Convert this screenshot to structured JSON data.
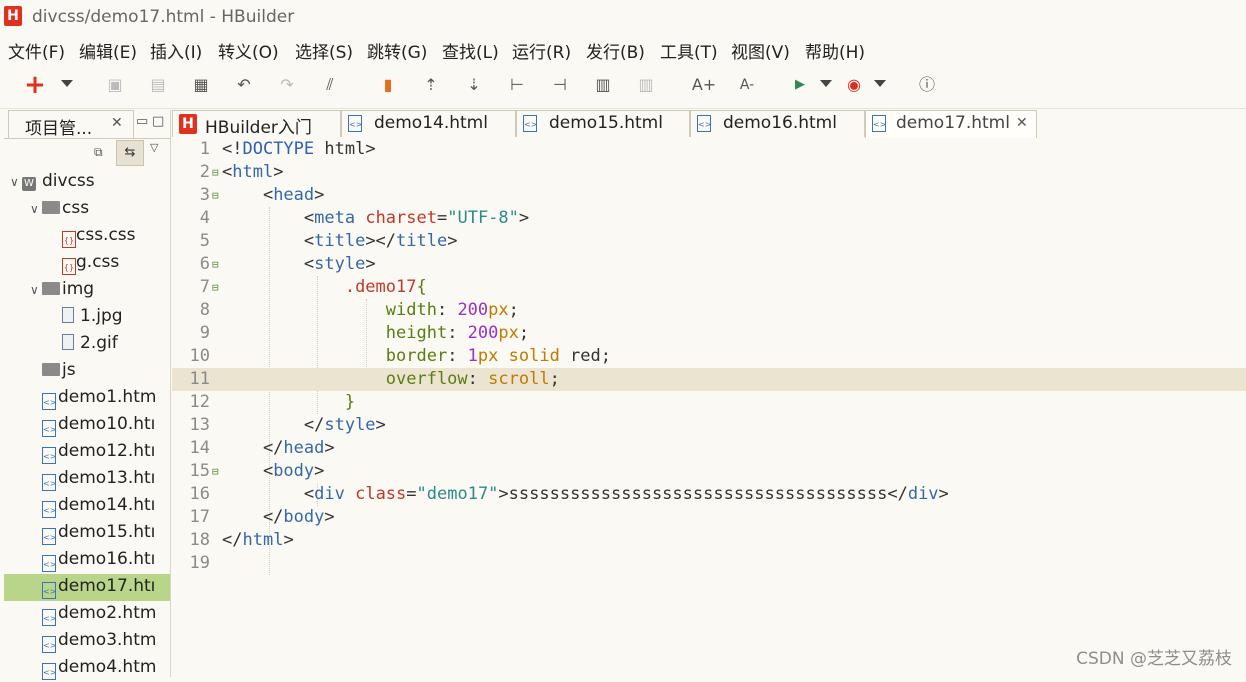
{
  "window": {
    "title": "divcss/demo17.html  -  HBuilder",
    "logo": "H"
  },
  "menu": [
    "文件(F)",
    "编辑(E)",
    "插入(I)",
    "转义(O)",
    "选择(S)",
    "跳转(G)",
    "查找(L)",
    "运行(R)",
    "发行(B)",
    "工具(T)",
    "视图(V)",
    "帮助(H)"
  ],
  "toolbar": {
    "icons": [
      "new-icon",
      "save-icon",
      "save-all-icon",
      "print-preview-icon",
      "undo-icon",
      "redo-icon",
      "format-icon",
      "bookmark-icon",
      "import-icon",
      "export-icon",
      "step-into-icon",
      "step-out-icon",
      "comment-icon",
      "uncomment-icon",
      "font-increase-icon",
      "font-decrease-icon",
      "run-icon",
      "browser-chrome-icon",
      "info-icon"
    ],
    "font_increase": "A+",
    "font_decrease": "A-"
  },
  "sidebar": {
    "tab_label": "项目管...",
    "tree": [
      {
        "label": "divcss",
        "type": "project",
        "indent": 0,
        "expanded": true
      },
      {
        "label": "css",
        "type": "folder",
        "indent": 1,
        "expanded": true
      },
      {
        "label": "css.css",
        "type": "css",
        "indent": 2
      },
      {
        "label": "g.css",
        "type": "css",
        "indent": 2
      },
      {
        "label": "img",
        "type": "folder",
        "indent": 1,
        "expanded": true
      },
      {
        "label": "1.jpg",
        "type": "image",
        "indent": 2
      },
      {
        "label": "2.gif",
        "type": "image",
        "indent": 2
      },
      {
        "label": "js",
        "type": "folder",
        "indent": 1
      },
      {
        "label": "demo1.htm",
        "type": "html",
        "indent": 1
      },
      {
        "label": "demo10.htı",
        "type": "html",
        "indent": 1
      },
      {
        "label": "demo12.htı",
        "type": "html",
        "indent": 1
      },
      {
        "label": "demo13.htı",
        "type": "html",
        "indent": 1
      },
      {
        "label": "demo14.htı",
        "type": "html",
        "indent": 1
      },
      {
        "label": "demo15.htı",
        "type": "html",
        "indent": 1
      },
      {
        "label": "demo16.htı",
        "type": "html",
        "indent": 1
      },
      {
        "label": "demo17.htı",
        "type": "html",
        "indent": 1,
        "selected": true
      },
      {
        "label": "demo2.htm",
        "type": "html",
        "indent": 1
      },
      {
        "label": "demo3.htm",
        "type": "html",
        "indent": 1
      },
      {
        "label": "demo4.htm",
        "type": "html",
        "indent": 1
      }
    ]
  },
  "tabs": [
    {
      "label": "HBuilder入门",
      "type": "hbuilder"
    },
    {
      "label": "demo14.html",
      "type": "html"
    },
    {
      "label": "demo15.html",
      "type": "html"
    },
    {
      "label": "demo16.html",
      "type": "html"
    },
    {
      "label": "demo17.html",
      "type": "html",
      "active": true
    }
  ],
  "editor": {
    "current_line": 11,
    "lines": [
      {
        "n": "1",
        "fold": false,
        "segs": [
          [
            "punct",
            "<!"
          ],
          [
            "kw",
            "DOCTYPE"
          ],
          [
            "punct",
            " html>"
          ]
        ]
      },
      {
        "n": "2",
        "fold": true,
        "segs": [
          [
            "punct",
            "<"
          ],
          [
            "tg",
            "html"
          ],
          [
            "punct",
            ">"
          ]
        ]
      },
      {
        "n": "3",
        "fold": true,
        "segs": [
          [
            "punct",
            "    <"
          ],
          [
            "tg",
            "head"
          ],
          [
            "punct",
            ">"
          ]
        ]
      },
      {
        "n": "4",
        "fold": false,
        "segs": [
          [
            "punct",
            "        <"
          ],
          [
            "tg",
            "meta"
          ],
          [
            "punct",
            " "
          ],
          [
            "attr",
            "charset"
          ],
          [
            "punct",
            "="
          ],
          [
            "str",
            "\"UTF-8\""
          ],
          [
            "punct",
            ">"
          ]
        ]
      },
      {
        "n": "5",
        "fold": false,
        "segs": [
          [
            "punct",
            "        <"
          ],
          [
            "tg",
            "title"
          ],
          [
            "punct",
            "></"
          ],
          [
            "tg",
            "title"
          ],
          [
            "punct",
            ">"
          ]
        ]
      },
      {
        "n": "6",
        "fold": true,
        "segs": [
          [
            "punct",
            "        <"
          ],
          [
            "tg",
            "style"
          ],
          [
            "punct",
            ">"
          ]
        ]
      },
      {
        "n": "7",
        "fold": true,
        "segs": [
          [
            "punct",
            "            "
          ],
          [
            "sel",
            ".demo17"
          ],
          [
            "brace",
            "{"
          ]
        ]
      },
      {
        "n": "8",
        "fold": false,
        "segs": [
          [
            "punct",
            "                "
          ],
          [
            "prop",
            "width"
          ],
          [
            "punct",
            ": "
          ],
          [
            "num",
            "200"
          ],
          [
            "val",
            "px"
          ],
          [
            "punct",
            ";"
          ]
        ]
      },
      {
        "n": "9",
        "fold": false,
        "segs": [
          [
            "punct",
            "                "
          ],
          [
            "prop",
            "height"
          ],
          [
            "punct",
            ": "
          ],
          [
            "num",
            "200"
          ],
          [
            "val",
            "px"
          ],
          [
            "punct",
            ";"
          ]
        ]
      },
      {
        "n": "10",
        "fold": false,
        "segs": [
          [
            "punct",
            "                "
          ],
          [
            "prop",
            "border"
          ],
          [
            "punct",
            ": "
          ],
          [
            "num",
            "1"
          ],
          [
            "val",
            "px solid"
          ],
          [
            "punct",
            " red;"
          ]
        ]
      },
      {
        "n": "11",
        "fold": false,
        "segs": [
          [
            "punct",
            "                "
          ],
          [
            "prop",
            "overflow"
          ],
          [
            "punct",
            ": "
          ],
          [
            "val",
            "scroll"
          ],
          [
            "punct",
            ";"
          ]
        ]
      },
      {
        "n": "12",
        "fold": false,
        "segs": [
          [
            "punct",
            "            "
          ],
          [
            "brace",
            "}"
          ]
        ]
      },
      {
        "n": "13",
        "fold": false,
        "segs": [
          [
            "punct",
            "        </"
          ],
          [
            "tg",
            "style"
          ],
          [
            "punct",
            ">"
          ]
        ]
      },
      {
        "n": "14",
        "fold": false,
        "segs": [
          [
            "punct",
            "    </"
          ],
          [
            "tg",
            "head"
          ],
          [
            "punct",
            ">"
          ]
        ]
      },
      {
        "n": "15",
        "fold": true,
        "segs": [
          [
            "punct",
            "    <"
          ],
          [
            "tg",
            "body"
          ],
          [
            "punct",
            ">"
          ]
        ]
      },
      {
        "n": "16",
        "fold": false,
        "segs": [
          [
            "punct",
            "        <"
          ],
          [
            "tg",
            "div"
          ],
          [
            "punct",
            " "
          ],
          [
            "attr",
            "class"
          ],
          [
            "punct",
            "="
          ],
          [
            "str",
            "\"demo17\""
          ],
          [
            "punct",
            ">sssssssssssssssssssssssssssssssssssss</"
          ],
          [
            "tg",
            "div"
          ],
          [
            "punct",
            ">"
          ]
        ]
      },
      {
        "n": "17",
        "fold": false,
        "segs": [
          [
            "punct",
            "    </"
          ],
          [
            "tg",
            "body"
          ],
          [
            "punct",
            ">"
          ]
        ]
      },
      {
        "n": "18",
        "fold": false,
        "segs": [
          [
            "punct",
            "</"
          ],
          [
            "tg",
            "html"
          ],
          [
            "punct",
            ">"
          ]
        ]
      },
      {
        "n": "19",
        "fold": false,
        "segs": []
      }
    ]
  },
  "watermark": "CSDN @芝芝又荔枝"
}
